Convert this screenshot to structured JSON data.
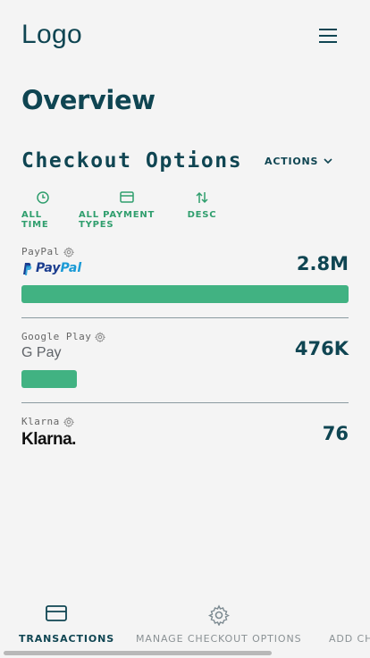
{
  "header": {
    "logo": "Logo"
  },
  "page": {
    "title": "Overview"
  },
  "checkout": {
    "title": "Checkout Options",
    "actions_label": "ACTIONS",
    "filters": [
      {
        "icon": "clock-icon",
        "label": "ALL TIME"
      },
      {
        "icon": "credit-card-icon",
        "label": "ALL PAYMENT TYPES"
      },
      {
        "icon": "sort-arrows-icon",
        "label": "DESC"
      }
    ],
    "options": [
      {
        "name": "PayPal",
        "brand": "PayPal",
        "value": "2.8M",
        "share": 1.0
      },
      {
        "name": "Google Play",
        "brand": "G Pay",
        "value": "476K",
        "share": 0.17
      },
      {
        "name": "Klarna",
        "brand": "Klarna.",
        "value": "76",
        "share": 0
      }
    ]
  },
  "bottom_nav": [
    {
      "icon": "credit-card-icon",
      "label": "TRANSACTIONS",
      "active": true
    },
    {
      "icon": "gear-icon",
      "label": "MANAGE CHECKOUT OPTIONS",
      "active": false
    },
    {
      "icon": "add-icon",
      "label": "ADD CH",
      "active": false
    }
  ],
  "colors": {
    "primary": "#0f4552",
    "accent": "#41b282",
    "accent_text": "#2f9e6d"
  }
}
